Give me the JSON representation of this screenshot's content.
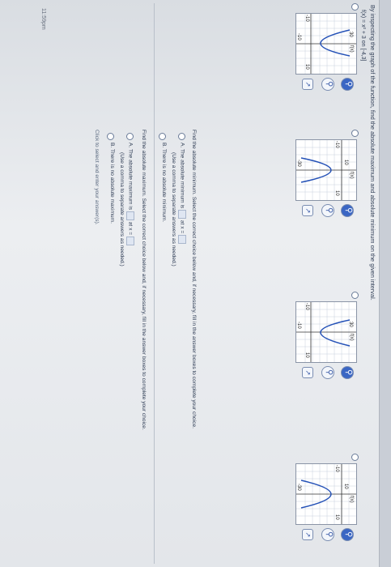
{
  "question": "By inspecting the graph of the function, find the absolute maximum and absolute minimum on the given interval.",
  "function": "f(x) = x² + 3 on [-4,3]",
  "graphs": [
    {
      "ylabel": "f(x)",
      "ytop": "30",
      "xleft": "-10",
      "xright": "10",
      "ybottom": "-10",
      "shape": "up"
    },
    {
      "ylabel": "f(x)",
      "ytop": "10",
      "xleft": "-10",
      "xright": "10",
      "ybottom": "-30",
      "shape": "down"
    },
    {
      "ylabel": "f(x)",
      "ytop": "30",
      "xleft": "-10",
      "xright": "10",
      "ybottom": "-10",
      "shape": "up"
    },
    {
      "ylabel": "f(x)",
      "ytop": "10",
      "xleft": "-10",
      "xright": "10",
      "ybottom": "-30",
      "shape": "down"
    }
  ],
  "min_prompt": "Find the absolute minimum. Select the correct choice below and, if necessary, fill in the answer boxes to complete your choice.",
  "min_a": "A. The absolute minimum is",
  "min_a_atx": "at x =",
  "min_a_note": "(Use a comma to separate answers as needed.)",
  "min_b": "B. There is no absolute minimum.",
  "max_prompt": "Find the absolute maximum. Select the correct choice below and, if necessary, fill in the answer boxes to complete your choice.",
  "max_a": "A. The absolute maximum is",
  "max_a_atx": "at x =",
  "max_a_note": "(Use a comma to separate answers as needed.)",
  "max_b": "B. There is no absolute maximum.",
  "footer": "Click to select and enter your answer(s).",
  "time": "11:59pm"
}
